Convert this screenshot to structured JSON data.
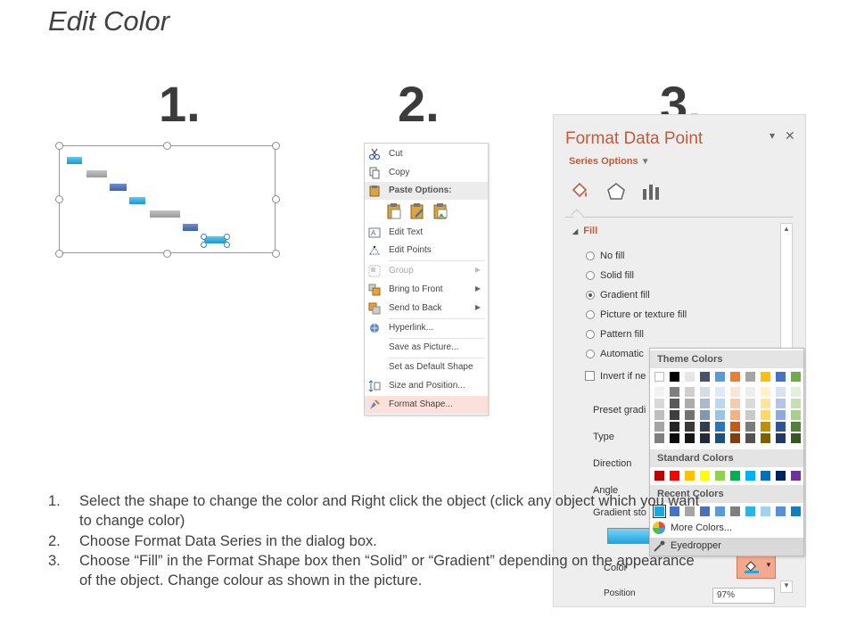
{
  "page": {
    "title": "Edit Color"
  },
  "steps": [
    "1.",
    "2.",
    "3."
  ],
  "panel1": {
    "bar_colors": [
      "#1ea6e0",
      "#a8a8a8",
      "#4a6fbf"
    ]
  },
  "context_menu": {
    "items": [
      {
        "label": "Cut",
        "icon": "scissors-icon"
      },
      {
        "label": "Copy",
        "icon": "copy-icon"
      },
      {
        "label": "Paste Options:",
        "icon": "paste-icon",
        "header": true
      },
      {
        "label": "Edit Text",
        "icon": "edit-text-icon"
      },
      {
        "label": "Edit Points",
        "icon": "edit-points-icon"
      },
      {
        "label": "Group",
        "icon": "group-icon",
        "disabled": true,
        "submenu": true
      },
      {
        "label": "Bring to Front",
        "icon": "bring-front-icon",
        "submenu": true
      },
      {
        "label": "Send to Back",
        "icon": "send-back-icon",
        "submenu": true
      },
      {
        "label": "Hyperlink...",
        "icon": "hyperlink-icon"
      },
      {
        "label": "Save as Picture...",
        "icon": ""
      },
      {
        "label": "Set as Default Shape",
        "icon": ""
      },
      {
        "label": "Size and Position...",
        "icon": "size-position-icon"
      },
      {
        "label": "Format Shape...",
        "icon": "format-shape-icon",
        "highlighted": true
      }
    ]
  },
  "format_pane": {
    "title": "Format Data Point",
    "series_options": "Series Options",
    "fill_header": "Fill",
    "fill_options": [
      "No fill",
      "Solid fill",
      "Gradient fill",
      "Picture or texture fill",
      "Pattern fill",
      "Automatic"
    ],
    "selected_fill": "Gradient fill",
    "invert_label": "Invert if ne",
    "labels": {
      "preset": "Preset gradi",
      "type": "Type",
      "direction": "Direction",
      "angle": "Angle",
      "gradient_stops": "Gradient sto",
      "color": "Color",
      "position": "Position"
    },
    "position_value": "97%",
    "accent_color": "#c55a3a"
  },
  "color_picker": {
    "theme_header": "Theme Colors",
    "standard_header": "Standard Colors",
    "recent_header": "Recent Colors",
    "more_colors": "More Colors...",
    "eyedropper": "Eyedropper",
    "theme_top": [
      "#ffffff",
      "#000000",
      "#e7e6e6",
      "#44546a",
      "#5b9bd5",
      "#ed7d31",
      "#a5a5a5",
      "#ffc000",
      "#4472c4",
      "#70ad47"
    ],
    "theme_shades": [
      [
        "#f2f2f2",
        "#7f7f7f",
        "#d0cece",
        "#d6dce4",
        "#deebf6",
        "#fbe5d5",
        "#ededed",
        "#fff2cc",
        "#d9e2f3",
        "#e2efd9"
      ],
      [
        "#d8d8d8",
        "#595959",
        "#aeabab",
        "#adb9ca",
        "#bdd7ee",
        "#f7cbac",
        "#dbdbdb",
        "#fee599",
        "#b4c6e7",
        "#c5e0b3"
      ],
      [
        "#bfbfbf",
        "#3f3f3f",
        "#757070",
        "#8496b0",
        "#9cc3e5",
        "#f4b183",
        "#c9c9c9",
        "#ffd965",
        "#8eaadb",
        "#a8d08d"
      ],
      [
        "#a5a5a5",
        "#262626",
        "#3a3838",
        "#323f4f",
        "#2e75b5",
        "#c55a11",
        "#7b7b7b",
        "#bf9000",
        "#2f5496",
        "#538135"
      ],
      [
        "#7f7f7f",
        "#0c0c0c",
        "#171616",
        "#222a35",
        "#1e4e79",
        "#833c0b",
        "#525252",
        "#7f6000",
        "#1f3864",
        "#375623"
      ]
    ],
    "standard": [
      "#c00000",
      "#ff0000",
      "#ffc000",
      "#ffff00",
      "#92d050",
      "#00b050",
      "#00b0f0",
      "#0070c0",
      "#002060",
      "#7030a0"
    ],
    "recent": [
      "#1ea6e0",
      "#4472c4",
      "#a5a5a5",
      "#4a6fbf",
      "#5b9bd5",
      "#7f7f7f",
      "#2bb4e8",
      "#9dd4f0",
      "#5b8ed6",
      "#0f7fc0"
    ]
  },
  "instructions": [
    {
      "num": "1.",
      "text": "Select the shape to change the color and Right click the object (click any object which you want",
      "cont": "to change color)"
    },
    {
      "num": "2.",
      "text": "Choose Format Data Series in the dialog box.",
      "cont": ""
    },
    {
      "num": "3.",
      "text": "Choose “Fill” in the Format Shape box then “Solid” or “Gradient” depending on the appearance",
      "cont": "of the object. Change colour as shown in the picture."
    }
  ]
}
